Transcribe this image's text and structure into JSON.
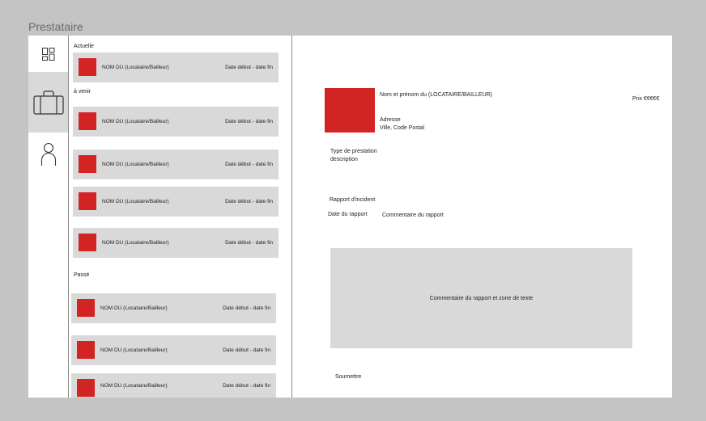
{
  "frame_title": "Prestataire",
  "nav": {
    "items": [
      {
        "name": "dashboard-icon"
      },
      {
        "name": "briefcase-icon"
      },
      {
        "name": "user-icon"
      }
    ]
  },
  "list": {
    "sections": {
      "current": "Actuelle",
      "upcoming": "à venir",
      "past": "Passé"
    },
    "card_name": "NOM DU (Locataire/Bailleur)",
    "card_dates": "Date début - date fin"
  },
  "detail": {
    "name_line": "Nom et prénom du (LOCATAIRE/BAILLEUR)",
    "address": "Adresse",
    "city": "Ville, Code Postal",
    "price": "Prix €€€€€",
    "service_type": "Type de prestation",
    "description": "description",
    "incident_report": "Rapport d'incident",
    "report_date": "Date du rapport",
    "report_comment": "Commentaire du rapport",
    "comment_box_text": "Commentaire du rapport et zone de texte",
    "submit": "Soumettre"
  },
  "colors": {
    "accent": "#d32424",
    "card_bg": "#d9d9d9",
    "canvas_bg": "#c4c4c4"
  }
}
